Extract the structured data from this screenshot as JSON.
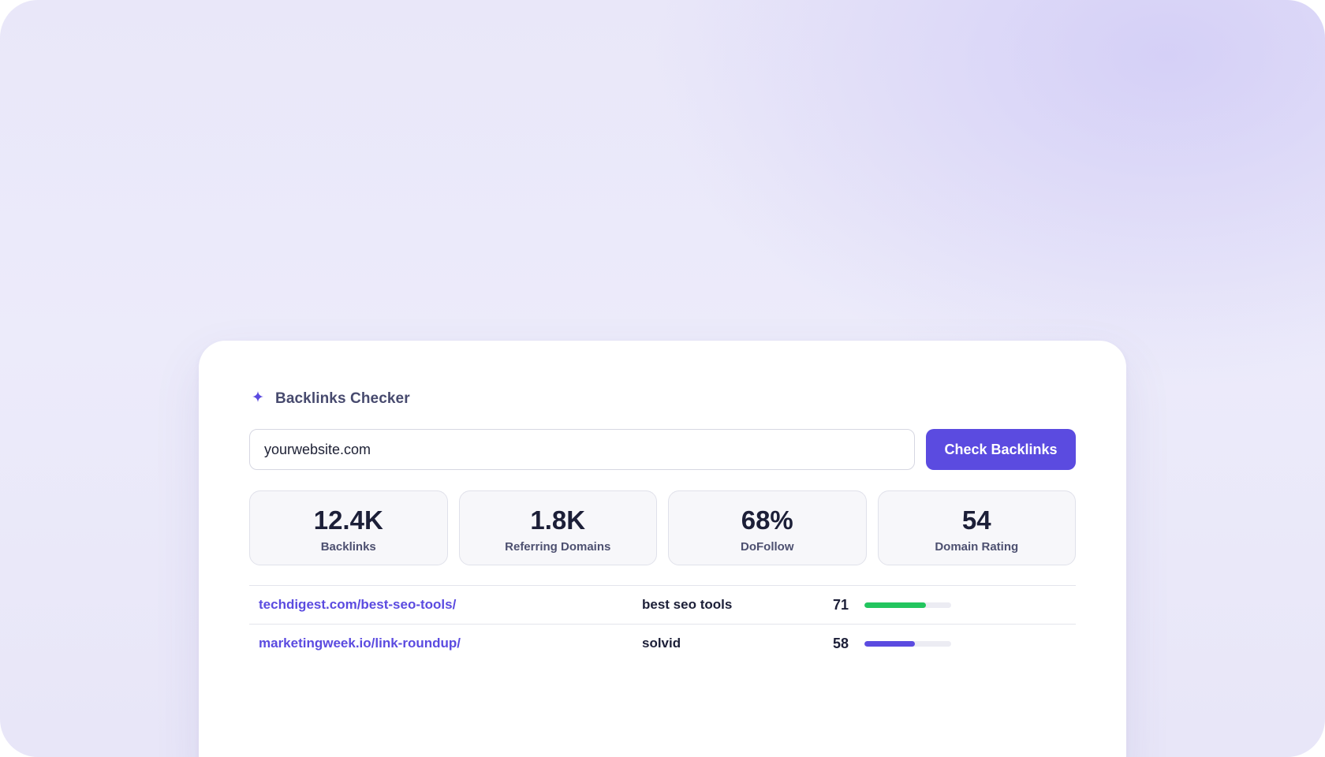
{
  "card": {
    "title": "Backlinks Checker",
    "icon": "sparkle-icon"
  },
  "search": {
    "value": "yourwebsite.com",
    "button_label": "Check Backlinks"
  },
  "stats": [
    {
      "value": "12.4K",
      "label": "Backlinks"
    },
    {
      "value": "1.8K",
      "label": "Referring Domains"
    },
    {
      "value": "68%",
      "label": "DoFollow"
    },
    {
      "value": "54",
      "label": "Domain Rating"
    }
  ],
  "backlinks": [
    {
      "url": "techdigest.com/best-seo-tools/",
      "anchor": "best seo tools",
      "score": "71",
      "strength": 0.71,
      "bar_color": "#22c55e"
    },
    {
      "url": "marketingweek.io/link-roundup/",
      "anchor": "solvid",
      "score": "58",
      "strength": 0.58,
      "bar_color": "#5b4be0"
    }
  ],
  "colors": {
    "accent": "#5b4be0",
    "success": "#22c55e"
  }
}
